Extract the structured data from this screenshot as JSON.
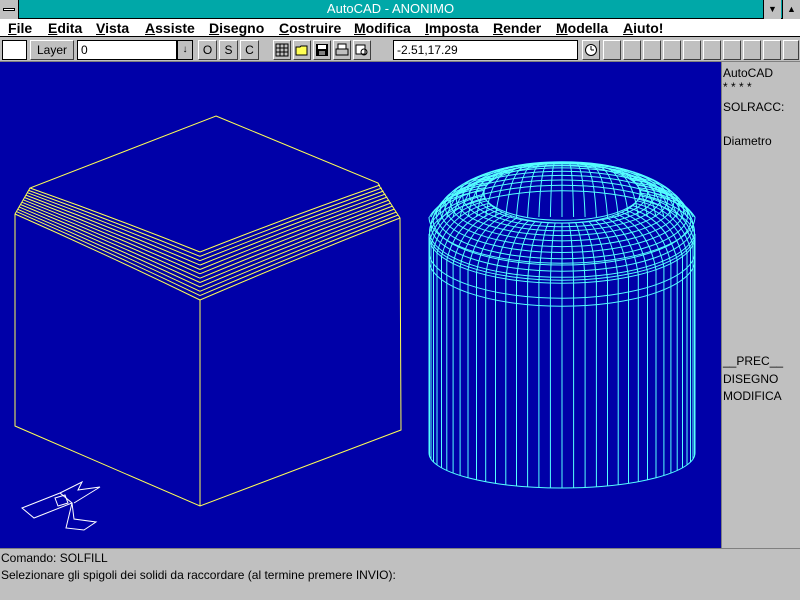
{
  "window": {
    "title": "AutoCAD - ANONIMO",
    "min_glyph": "▼",
    "max_glyph": "▲"
  },
  "menu": {
    "items": [
      {
        "ul": "F",
        "rest": "ile"
      },
      {
        "ul": "E",
        "rest": "dita"
      },
      {
        "ul": "V",
        "rest": "ista"
      },
      {
        "ul": "A",
        "rest": "ssiste"
      },
      {
        "ul": "D",
        "rest": "isegno"
      },
      {
        "ul": "C",
        "rest": "ostruire"
      },
      {
        "ul": "M",
        "rest": "odifica"
      },
      {
        "ul": "I",
        "rest": "mposta"
      },
      {
        "ul": "R",
        "rest": "ender"
      },
      {
        "ul": "M",
        "rest": "odella"
      },
      {
        "ul": "A",
        "rest": "iuto!"
      }
    ]
  },
  "toolbar": {
    "layer_button": "Layer",
    "layer_value": "0",
    "layer_dropdown_glyph": "↓",
    "o_button": "O",
    "s_button": "S",
    "c_button": "C",
    "coords": "-2.51,17.29",
    "icons": [
      "grid-icon",
      "open-folder-icon",
      "save-icon",
      "print-icon",
      "preview-icon",
      "clock-icon"
    ]
  },
  "sidemenu": {
    "items": [
      "AutoCAD",
      "* * * *",
      "SOLRACC:",
      "Diametro",
      "__PREC__",
      "DISEGNO",
      "MODIFICA"
    ]
  },
  "command": {
    "line1": "Comando: SOLFILL",
    "line2": "Selezionare gli spigoli dei solidi da raccordare (al termine premere INVIO):"
  },
  "colors": {
    "canvas": "#0000a8",
    "box_wire": "#ffff54",
    "cylinder_wire": "#54ffff",
    "ucs_icon": "#ffffff",
    "titlebar": "#00a8a8"
  }
}
